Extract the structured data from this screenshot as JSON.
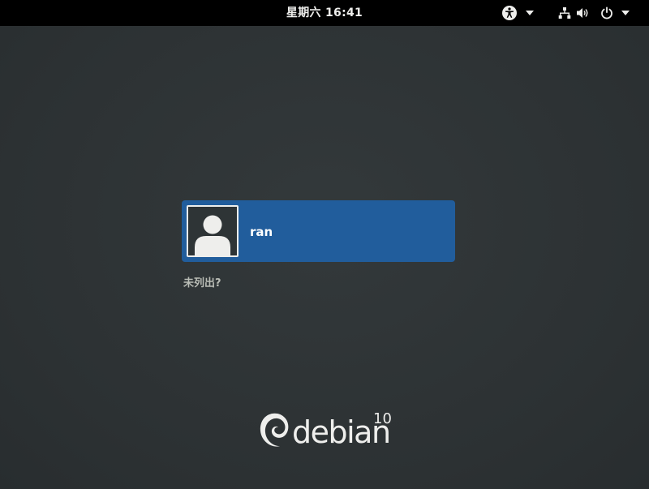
{
  "topbar": {
    "clock": "星期六 16:41",
    "accessibility_icon": "accessibility-icon",
    "network_icon": "network-wired-icon",
    "volume_icon": "volume-icon",
    "power_icon": "power-icon",
    "menu_arrow_icon": "chevron-down-icon"
  },
  "login": {
    "users": [
      {
        "name": "ran",
        "avatar_icon": "user-avatar-icon"
      }
    ],
    "not_listed_label": "未列出?"
  },
  "branding": {
    "logo_word": "debian",
    "version": "10",
    "logo_icon": "debian-swirl-icon"
  },
  "colors": {
    "background": "#2e3436",
    "topbar": "#000000",
    "selected_user": "#215d9c",
    "text": "#eeeeec",
    "muted_text": "#babdb6"
  }
}
